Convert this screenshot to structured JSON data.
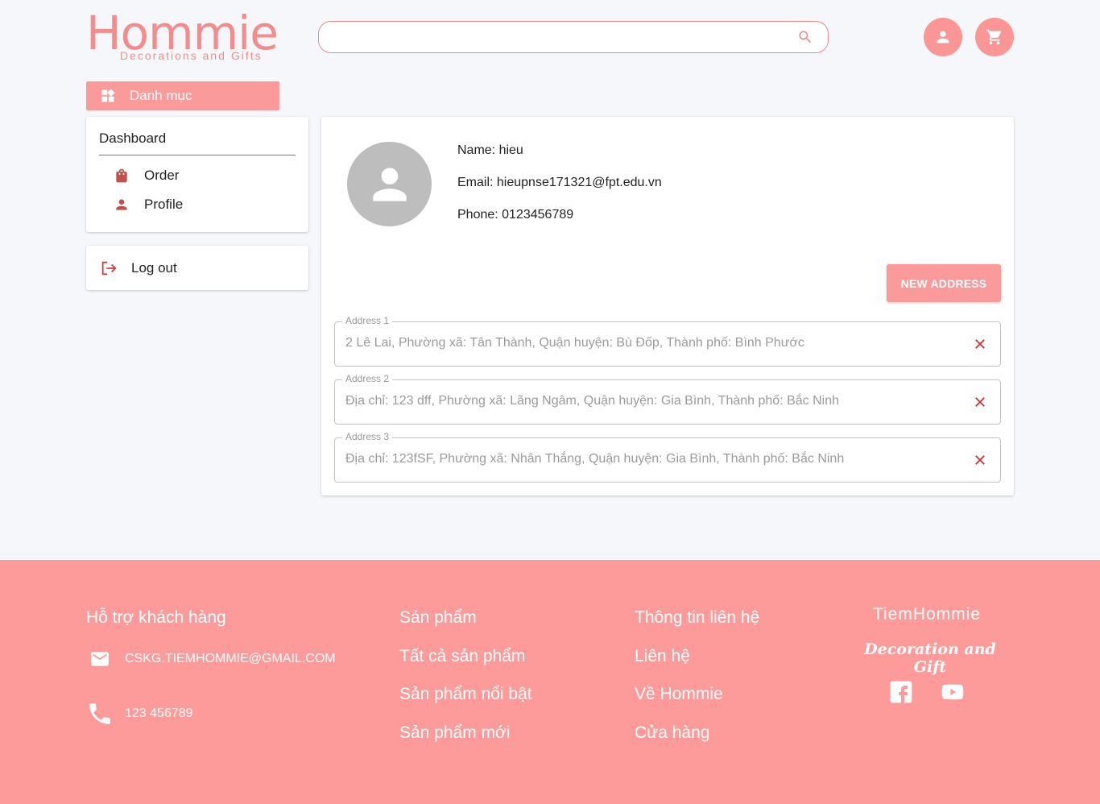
{
  "header": {
    "logo_main": "Hommie",
    "logo_sub": "Decorations and Gifts",
    "search_placeholder": ""
  },
  "category_button": "Danh mục",
  "sidebar": {
    "dashboard_title": "Dashboard",
    "items": [
      {
        "label": "Order",
        "icon": "shopping-bag-icon"
      },
      {
        "label": "Profile",
        "icon": "person-icon"
      }
    ],
    "logout_label": "Log out"
  },
  "profile": {
    "name": "Name: hieu",
    "email": "Email: hieupnse171321@fpt.edu.vn",
    "phone": "Phone: 0123456789"
  },
  "new_address_label": "NEW ADDRESS",
  "addresses": [
    {
      "legend": "Address 1",
      "value": "2 Lê Lai, Phường xã: Tân Thành, Quận huyện: Bù Đốp, Thành phố: Bình Phước"
    },
    {
      "legend": "Address 2",
      "value": "Địa chỉ: 123 dff, Phường xã: Lãng Ngâm, Quận huyện: Gia Bình, Thành phố: Bắc Ninh"
    },
    {
      "legend": "Address 3",
      "value": "Địa chỉ: 123fSF, Phường xã: Nhân Thắng, Quận huyện: Gia Bình, Thành phố: Bắc Ninh"
    }
  ],
  "footer": {
    "support": {
      "title": "Hỗ trợ khách hàng",
      "email": "CSKG.TIEMHOMMIE@GMAIL.COM",
      "phone": "123 456789"
    },
    "products": {
      "title": "Sản phẩm",
      "links": [
        "Tất cả sản phẩm",
        "Sản phẩm nổi bật",
        "Sản phẩm mới"
      ]
    },
    "contact": {
      "title": "Thông tin liên hệ",
      "links": [
        "Liên hệ",
        "Về Hommie",
        "Cửa hàng"
      ]
    },
    "brand": {
      "title": "TiemHommie",
      "subtitle": "Decoration and Gift"
    }
  },
  "colors": {
    "accent": "#fb9a9a",
    "logo": "#f48c8c",
    "delete": "#d32f2f",
    "footer_bg": "#fd9b9b"
  }
}
